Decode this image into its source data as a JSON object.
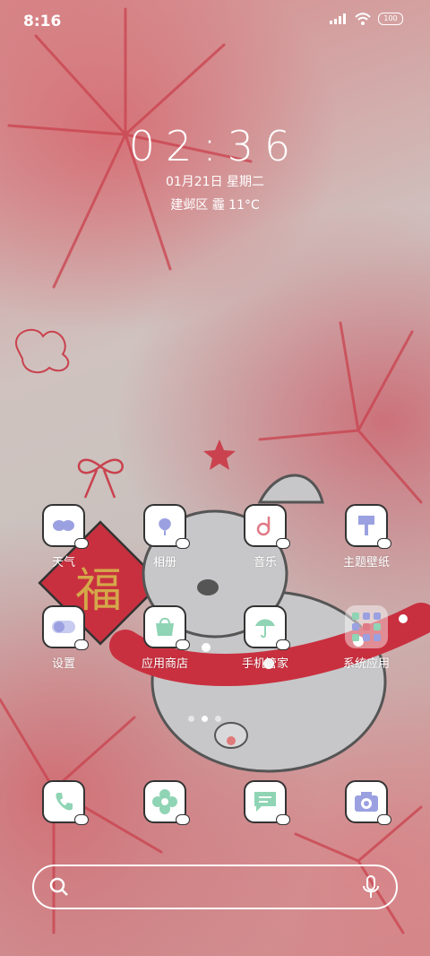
{
  "status": {
    "time": "8:16",
    "battery": "100"
  },
  "lock": {
    "clock": "02:36",
    "date": "01月21日 星期二",
    "weather": "建邺区 霾 11°C"
  },
  "apps": [
    {
      "label": "天气",
      "icon": "weather-icon"
    },
    {
      "label": "相册",
      "icon": "gallery-icon"
    },
    {
      "label": "音乐",
      "icon": "music-icon"
    },
    {
      "label": "主题壁纸",
      "icon": "theme-icon"
    },
    {
      "label": "设置",
      "icon": "settings-icon"
    },
    {
      "label": "应用商店",
      "icon": "app-store-icon"
    },
    {
      "label": "手机管家",
      "icon": "security-icon"
    },
    {
      "label": "系统应用",
      "icon": "folder-icon"
    }
  ],
  "dock": [
    {
      "icon": "phone-icon"
    },
    {
      "icon": "flower-icon"
    },
    {
      "icon": "messages-icon"
    },
    {
      "icon": "camera-icon"
    }
  ],
  "wallpaper": {
    "character": "福"
  },
  "page_indicator": {
    "pages": 3,
    "current": 2
  },
  "colors": {
    "accent": "#ffffff",
    "outline": "#333333",
    "wallpaper_red": "#c9424e"
  }
}
